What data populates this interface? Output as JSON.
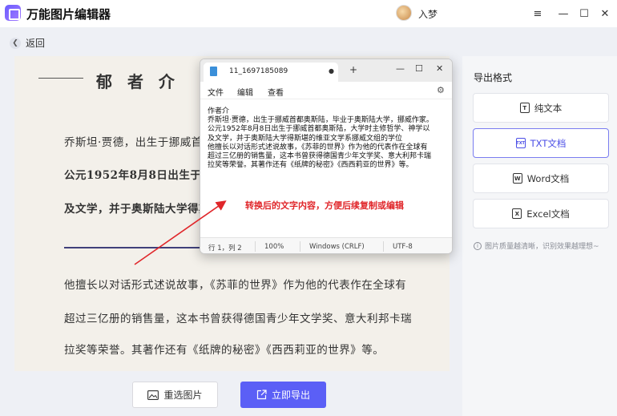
{
  "app": {
    "title": "万能图片编辑器",
    "user_name": "入梦"
  },
  "window_controls": {
    "menu": "≡",
    "minimize": "—",
    "maximize": "☐",
    "close": "✕"
  },
  "nav": {
    "back_label": "返回"
  },
  "document": {
    "heading": "郁 者 介",
    "lines": [
      "乔斯坦·贾德，出生于挪威首都",
      "公元1952年8月8日出生于挪威",
      "及文学，并于奥斯陆大学得斯",
      "他擅长以对话形式述说故事，《苏菲的世界》作为他的代表作在全球有",
      "超过三亿册的销售量，这本书曾获得德国青少年文学奖、意大利邦卡瑞",
      "拉奖等荣誉。其著作还有《纸牌的秘密》《西西莉亚的世界》等。"
    ]
  },
  "bottom": {
    "reselect_label": "重选图片",
    "export_label": "立即导出"
  },
  "right_panel": {
    "title": "导出格式",
    "formats": [
      {
        "label": "纯文本",
        "icon": "T"
      },
      {
        "label": "TXT文档",
        "icon": "TXT"
      },
      {
        "label": "Word文档",
        "icon": "W"
      },
      {
        "label": "Excel文档",
        "icon": "X"
      }
    ],
    "hint": "图片质量越清晰，识别效果越理想~"
  },
  "notepad": {
    "tab_title": "11_1697185089",
    "menus": [
      "文件",
      "编辑",
      "查看"
    ],
    "content": [
      "作者介",
      "乔斯坦·贾德，出生于挪威首都奥斯陆，毕业于奥斯陆大学，挪威作家。",
      "公元1952年8月8日出生于挪威首都奥斯陆，大学时主修哲学、神学以",
      "及文学，并于奥斯陆大学得斯堪的维亚文学系挪威文组的学位",
      "他擅长以对话形式述说故事，《苏菲的世界》作为他的代表作在全球有",
      "超过三亿册的销售量，这本书曾获得德国青少年文学奖、意大利邦卡瑞",
      "拉奖等荣誉。其著作还有《纸牌的秘密》《西西莉亚的世界》等。"
    ],
    "annotation": "转换后的文字内容，方便后续复制或编辑",
    "status": {
      "position": "行 1，列 2",
      "zoom": "100%",
      "line_ending": "Windows (CRLF)",
      "encoding": "UTF-8"
    }
  },
  "colors": {
    "accent": "#5b5ff6",
    "annotation": "#e0262a"
  }
}
